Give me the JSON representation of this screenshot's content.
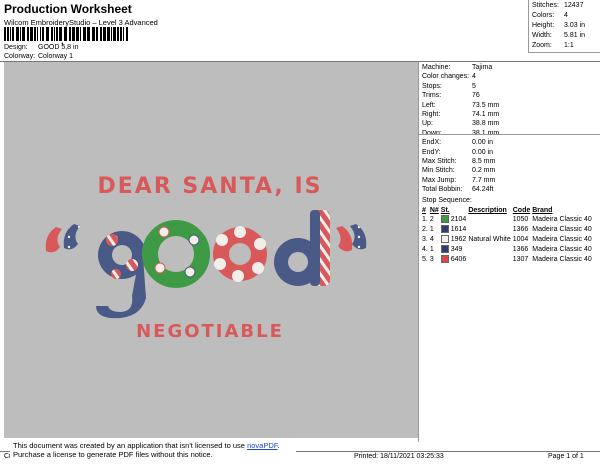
{
  "header": {
    "title": "Production Worksheet",
    "subtitle": "Wilcom EmbroideryStudio – Level 3 Advanced",
    "barcode_tick": ",",
    "design_label": "Design:",
    "design_value": "GOOD 5,8 in",
    "colorway_label": "Colorway:",
    "colorway_value": "Colorway 1"
  },
  "stats": [
    {
      "k": "Stitches:",
      "v": "12437"
    },
    {
      "k": "Colors:",
      "v": "4"
    },
    {
      "k": "Height:",
      "v": "3.03 in"
    },
    {
      "k": "Width:",
      "v": "5.81 in"
    },
    {
      "k": "Zoom:",
      "v": "1:1"
    }
  ],
  "info": [
    {
      "k": "Machine:",
      "v": "Tajima"
    },
    {
      "k": "Color changes:",
      "v": "4"
    },
    {
      "k": "Stops:",
      "v": "5"
    },
    {
      "k": "Trims:",
      "v": "76"
    },
    {
      "k": "Left:",
      "v": "73.5 mm"
    },
    {
      "k": "Right:",
      "v": "74.1 mm"
    },
    {
      "k": "Up:",
      "v": "38.8 mm"
    },
    {
      "k": "Down:",
      "v": "38.1 mm"
    },
    {
      "k": "EndX:",
      "v": "0.00 in"
    },
    {
      "k": "EndY:",
      "v": "0.00 in"
    },
    {
      "k": "Max Stitch:",
      "v": "8.5 mm"
    },
    {
      "k": "Min Stitch:",
      "v": "0.2 mm"
    },
    {
      "k": "Max Jump:",
      "v": "7.7 mm"
    },
    {
      "k": "Total Bobbin:",
      "v": "64.24ft"
    }
  ],
  "stop_sequence": {
    "title": "Stop Sequence:",
    "headers": [
      "#",
      "N#",
      "St.",
      "Description",
      "Code",
      "Brand"
    ],
    "rows": [
      {
        "num": "1.",
        "n": "2",
        "st": "2104",
        "desc": "",
        "code": "1050",
        "brand": "Madeira Classic 40",
        "color": "#3f9a46"
      },
      {
        "num": "2.",
        "n": "1",
        "st": "1614",
        "desc": "",
        "code": "1366",
        "brand": "Madeira Classic 40",
        "color": "#2f3e6a"
      },
      {
        "num": "3.",
        "n": "4",
        "st": "1962",
        "desc": "Natural White",
        "code": "1004",
        "brand": "Madeira Classic 40",
        "color": "#f4f1ea"
      },
      {
        "num": "4.",
        "n": "1",
        "st": "349",
        "desc": "",
        "code": "1366",
        "brand": "Madeira Classic 40",
        "color": "#2f3e6a"
      },
      {
        "num": "5.",
        "n": "3",
        "st": "6406",
        "desc": "",
        "code": "1307",
        "brand": "Madeira Classic 40",
        "color": "#d24a4a"
      }
    ]
  },
  "design": {
    "line1": "DEAR SANTA, IS",
    "line2": "NEGOTIABLE",
    "colors": {
      "red": "#d9595a",
      "navy": "#4a5a86",
      "green": "#3f9a46",
      "white": "#f2efe8"
    }
  },
  "notice": {
    "text1": "This document was created by an application that isn't licensed to use ",
    "link": "novaPDF",
    "text1_end": ".",
    "text2": "Purchase a license to generate PDF files without this notice."
  },
  "footer": {
    "left": "Cr",
    "printed": "Printed: 18/11/2021 03:25:33",
    "page": "Page 1 of 1"
  }
}
